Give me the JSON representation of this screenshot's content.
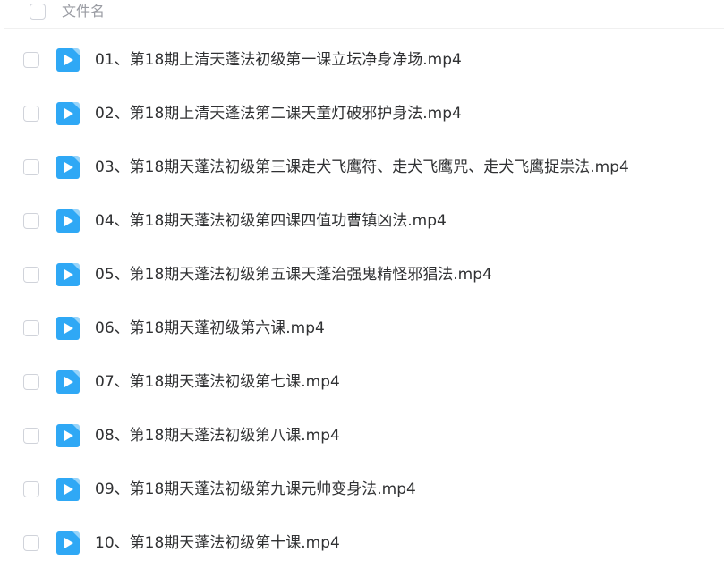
{
  "header": {
    "column_label": "文件名"
  },
  "files": [
    {
      "name": "01、第18期上清天蓬法初级第一课立坛净身净场.mp4",
      "icon": "video-file-icon"
    },
    {
      "name": "02、第18期上清天蓬法第二课天童灯破邪护身法.mp4",
      "icon": "video-file-icon"
    },
    {
      "name": "03、第18期天蓬法初级第三课走犬飞鹰符、走犬飞鹰咒、走犬飞鹰捉祟法.mp4",
      "icon": "video-file-icon"
    },
    {
      "name": "04、第18期天蓬法初级第四课四值功曹镇凶法.mp4",
      "icon": "video-file-icon"
    },
    {
      "name": "05、第18期天蓬法初级第五课天蓬治强鬼精怪邪猖法.mp4",
      "icon": "video-file-icon"
    },
    {
      "name": "06、第18期天蓬初级第六课.mp4",
      "icon": "video-file-icon"
    },
    {
      "name": "07、第18期天蓬法初级第七课.mp4",
      "icon": "video-file-icon"
    },
    {
      "name": "08、第18期天蓬法初级第八课.mp4",
      "icon": "video-file-icon"
    },
    {
      "name": "09、第18期天蓬法初级第九课元帅变身法.mp4",
      "icon": "video-file-icon"
    },
    {
      "name": "10、第18期天蓬法初级第十课.mp4",
      "icon": "video-file-icon"
    }
  ],
  "colors": {
    "icon_blue": "#2fa8f5",
    "text": "#303133",
    "header_text": "#9a9ca3",
    "checkbox_border": "#d0d3da"
  }
}
